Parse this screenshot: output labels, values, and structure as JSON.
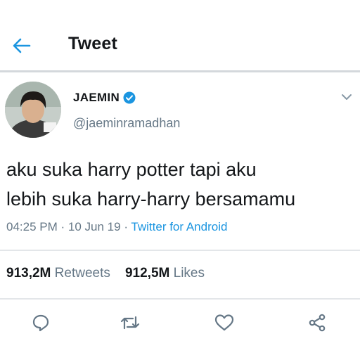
{
  "header": {
    "title": "Tweet",
    "back_icon": "arrow-left-icon"
  },
  "author": {
    "display_name": "JAEMIN",
    "handle": "@jaeminramadhan",
    "verified_icon": "verified-badge-icon"
  },
  "tweet": {
    "text_line1": "aku suka harry potter tapi aku",
    "text_line2": "lebih suka harry-harry bersamamu",
    "time": "04:25 PM",
    "date": "10 Jun 19",
    "separator": "·",
    "source": "Twitter for Android"
  },
  "stats": {
    "retweets_count": "913,2M",
    "retweets_label": "Retweets",
    "likes_count": "912,5M",
    "likes_label": "Likes"
  },
  "actions": [
    "reply-icon",
    "retweet-icon",
    "like-icon",
    "share-icon"
  ],
  "colors": {
    "accent": "#1b95e0",
    "secondary_text": "#657786",
    "primary_text": "#14171a"
  }
}
